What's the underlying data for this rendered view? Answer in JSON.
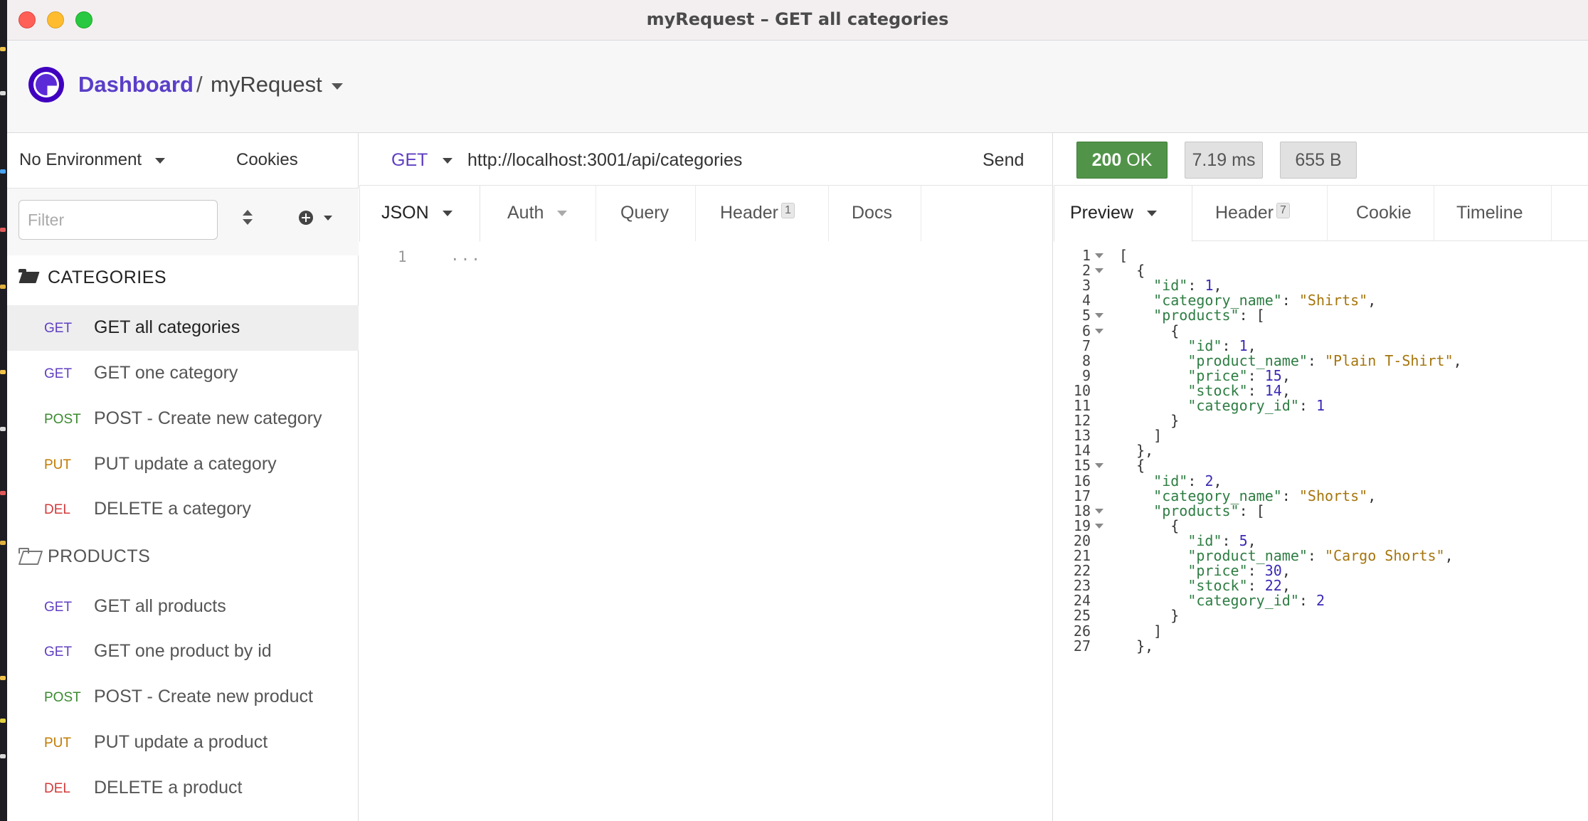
{
  "window": {
    "title": "myRequest – GET all categories"
  },
  "header": {
    "dashboard_link": "Dashboard",
    "separator": "/",
    "workspace_name": "myRequest"
  },
  "sidebar": {
    "environment": "No Environment",
    "cookies_label": "Cookies",
    "filter_placeholder": "Filter",
    "folders": [
      {
        "name": "CATEGORIES",
        "requests": [
          {
            "method": "GET",
            "name": "GET all categories"
          },
          {
            "method": "GET",
            "name": "GET one category"
          },
          {
            "method": "POST",
            "name": "POST - Create new category"
          },
          {
            "method": "PUT",
            "name": "PUT update a category"
          },
          {
            "method": "DEL",
            "name": "DELETE a category"
          }
        ]
      },
      {
        "name": "PRODUCTS",
        "requests": [
          {
            "method": "GET",
            "name": "GET all products"
          },
          {
            "method": "GET",
            "name": "GET one product by id"
          },
          {
            "method": "POST",
            "name": "POST - Create new product"
          },
          {
            "method": "PUT",
            "name": "PUT update a product"
          },
          {
            "method": "DEL",
            "name": "DELETE a product"
          }
        ]
      }
    ]
  },
  "request": {
    "method": "GET",
    "url": "http://localhost:3001/api/categories",
    "send_label": "Send",
    "tabs": {
      "json": "JSON",
      "auth": "Auth",
      "query": "Query",
      "header": "Header",
      "header_count": "1",
      "docs": "Docs"
    },
    "body_line_number": "1",
    "body_placeholder": "..."
  },
  "response": {
    "status_code": "200",
    "status_text": "OK",
    "time": "7.19 ms",
    "size": "655 B",
    "tabs": {
      "preview": "Preview",
      "header": "Header",
      "header_count": "7",
      "cookie": "Cookie",
      "timeline": "Timeline"
    },
    "body_lines": [
      "[",
      "  {",
      "    \"id\": 1,",
      "    \"category_name\": \"Shirts\",",
      "    \"products\": [",
      "      {",
      "        \"id\": 1,",
      "        \"product_name\": \"Plain T-Shirt\",",
      "        \"price\": 15,",
      "        \"stock\": 14,",
      "        \"category_id\": 1",
      "      }",
      "    ]",
      "  },",
      "  {",
      "    \"id\": 2,",
      "    \"category_name\": \"Shorts\",",
      "    \"products\": [",
      "      {",
      "        \"id\": 5,",
      "        \"product_name\": \"Cargo Shorts\",",
      "        \"price\": 30,",
      "        \"stock\": 22,",
      "        \"category_id\": 2",
      "      }",
      "    ]",
      "  },"
    ],
    "foldable_lines": [
      1,
      2,
      5,
      6,
      15,
      18,
      19
    ]
  },
  "colors": {
    "accent": "#5a3ec8",
    "status_ok": "#519449",
    "method_get": "#5f3ec3",
    "method_post": "#3a8a2e",
    "method_put": "#c07a00",
    "method_del": "#d23b3b"
  }
}
